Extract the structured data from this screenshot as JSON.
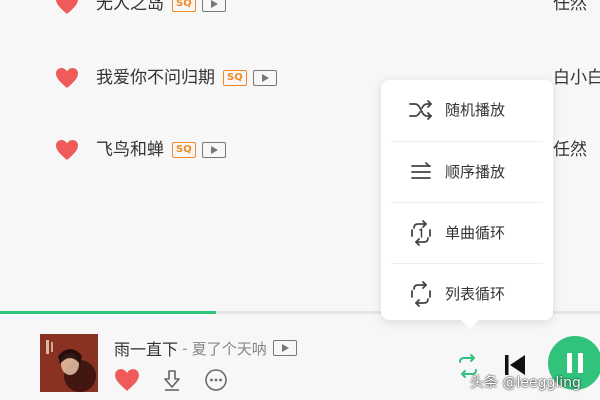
{
  "songs": [
    {
      "title": "无人之岛",
      "badge": "SQ",
      "artist": "任然"
    },
    {
      "title": "我爱你不问归期",
      "badge": "SQ",
      "artist": "白小白"
    },
    {
      "title": "飞鸟和蝉",
      "badge": "SQ",
      "artist": "任然"
    }
  ],
  "mode_menu": {
    "items": [
      {
        "label": "随机播放",
        "icon": "shuffle-icon"
      },
      {
        "label": "顺序播放",
        "icon": "sequential-icon"
      },
      {
        "label": "单曲循环",
        "icon": "repeat-one-icon"
      },
      {
        "label": "列表循环",
        "icon": "repeat-list-icon"
      }
    ]
  },
  "now_playing": {
    "title": "雨一直下",
    "separator": "-",
    "artist": "夏了个天呐",
    "progress": 0.36
  },
  "watermark": "头条 @leeggling",
  "colors": {
    "accent": "#31c27c",
    "heart": "#ef5b5b",
    "sq_badge": "#f08a24"
  }
}
